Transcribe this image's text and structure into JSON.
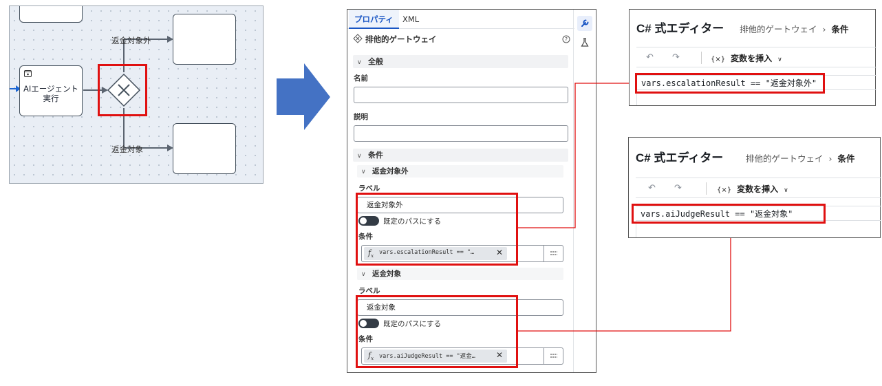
{
  "canvas": {
    "task_label_line1": "AIエージェント",
    "task_label_line2": "実行",
    "edge_top_label": "返金対象外",
    "edge_bottom_label": "返金対象"
  },
  "panel": {
    "tabs": [
      {
        "label": "プロパティ",
        "active": true
      },
      {
        "label": "XML",
        "active": false
      }
    ],
    "element_type": "排他的ゲートウェイ",
    "general_section": "全般",
    "name_label": "名前",
    "name_value": "",
    "description_label": "説明",
    "description_value": "",
    "conditions_section": "条件",
    "paths": [
      {
        "header": "返金対象外",
        "label_title": "ラベル",
        "label_value": "返金対象外",
        "default_toggle": "既定のパスにする",
        "condition_title": "条件",
        "condition_chip": "vars.escalationResult == \"…"
      },
      {
        "header": "返金対象",
        "label_title": "ラベル",
        "label_value": "返金対象",
        "default_toggle": "既定のパスにする",
        "condition_title": "条件",
        "condition_chip": "vars.aiJudgeResult == \"返金…"
      }
    ]
  },
  "editors": [
    {
      "title": "C# 式エディター",
      "breadcrumb_parent": "排他的ゲートウェイ",
      "breadcrumb_sep": "›",
      "breadcrumb_current": "条件",
      "insert_var_label": "変数を挿入",
      "code": "vars.escalationResult == \"返金対象外\""
    },
    {
      "title": "C# 式エディター",
      "breadcrumb_parent": "排他的ゲートウェイ",
      "breadcrumb_sep": "›",
      "breadcrumb_current": "条件",
      "insert_var_label": "変数を挿入",
      "code": "vars.aiJudgeResult == \"返金対象\""
    }
  ],
  "colors": {
    "highlight_red": "#e01010",
    "arrow_blue": "#4472c4",
    "tab_accent": "#1a56c4"
  }
}
